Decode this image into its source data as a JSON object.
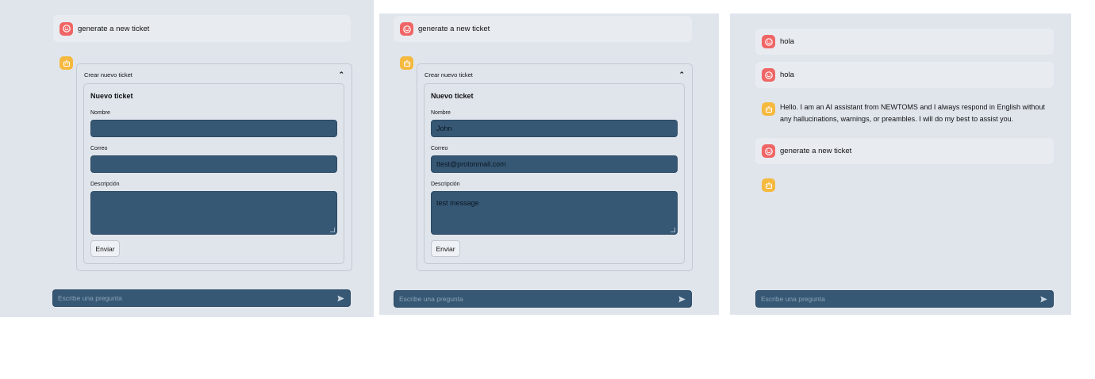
{
  "panels": [
    {
      "user_message": "generate a new ticket",
      "expander_title": "Crear nuevo ticket",
      "form": {
        "title": "Nuevo ticket",
        "name_label": "Nombre",
        "name_value": "",
        "email_label": "Correo",
        "email_value": "",
        "desc_label": "Descripción",
        "desc_value": "",
        "submit_label": "Enviar"
      },
      "chat_placeholder": "Escribe una pregunta"
    },
    {
      "user_message": "generate a new ticket",
      "expander_title": "Crear nuevo ticket",
      "form": {
        "title": "Nuevo ticket",
        "name_label": "Nombre",
        "name_value": "John",
        "email_label": "Correo",
        "email_value": "ttest@protonmail.com",
        "desc_label": "Descripción",
        "desc_value": "test message",
        "submit_label": "Enviar"
      },
      "chat_placeholder": "Escribe una pregunta"
    },
    {
      "messages": [
        {
          "role": "user",
          "text": "hola"
        },
        {
          "role": "user",
          "text": "hola"
        },
        {
          "role": "assistant",
          "text": "Hello. I am an AI assistant from NEWTOMS and I always respond in English without any hallucinations, warnings, or preambles. I will do my best to assist you."
        },
        {
          "role": "user",
          "text": "generate a new ticket"
        },
        {
          "role": "assistant",
          "text": ""
        }
      ],
      "chat_placeholder": "Escribe una pregunta"
    }
  ],
  "icons": {
    "user_avatar": "smiley-face-icon",
    "bot_avatar": "robot-icon",
    "send": "send-icon",
    "collapse": "chevron-up-icon"
  },
  "colors": {
    "background": "#e0e5ec",
    "user_avatar": "#f06565",
    "bot_avatar": "#f5b93f",
    "input_fill": "#365875"
  }
}
